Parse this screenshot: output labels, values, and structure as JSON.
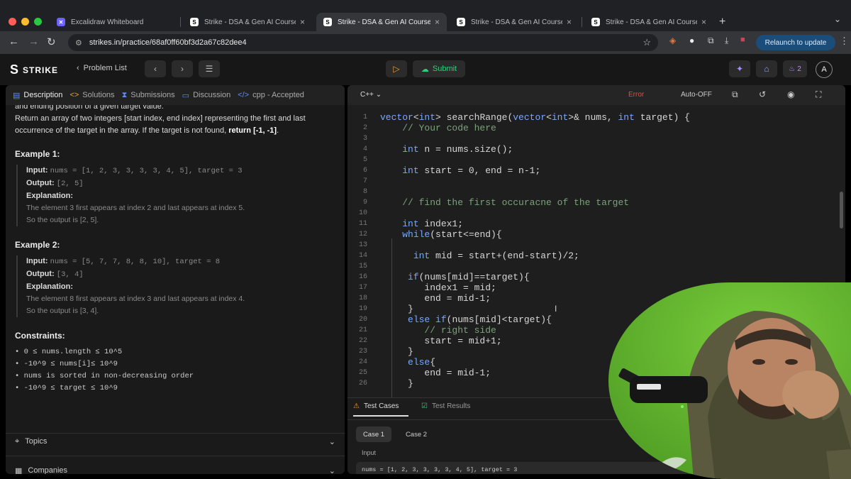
{
  "browser": {
    "tabs": [
      {
        "title": "Excalidraw Whiteboard",
        "active": false
      },
      {
        "title": "Strike - DSA & Gen AI Course",
        "active": false
      },
      {
        "title": "Strike - DSA & Gen AI Course",
        "active": true
      },
      {
        "title": "Strike - DSA & Gen AI Course",
        "active": false
      },
      {
        "title": "Strike - DSA & Gen AI Course",
        "active": false
      }
    ],
    "url": "strikes.in/practice/68af0ff60bf3d2a67c82dee4",
    "relaunch_label": "Relaunch to update"
  },
  "app": {
    "logo": "STRIKE",
    "problem_list": "Problem List",
    "submit_label": "Submit",
    "streak_count": "2",
    "avatar_letter": "A"
  },
  "left_tabs": [
    {
      "label": "Description",
      "icon": "document-icon"
    },
    {
      "label": "Solutions",
      "icon": "code-icon"
    },
    {
      "label": "Submissions",
      "icon": "hourglass-icon"
    },
    {
      "label": "Discussion",
      "icon": "chat-icon"
    },
    {
      "label": "cpp - Accepted",
      "icon": "code-icon"
    }
  ],
  "description": {
    "intro1": "and ending position of a given target value.",
    "intro2a": "Return an array of two integers [start index, end index] representing the first and last occurrence of the target in the array. If the target is not found, ",
    "intro2b": "return [-1, -1]",
    "intro2c": ".",
    "examples": [
      {
        "heading": "Example 1:",
        "input": "nums = [1, 2, 3, 3, 3, 3, 4, 5], target = 3",
        "output": "[2, 5]",
        "explanation1": "The element 3 first appears at index 2 and last appears at index 5.",
        "explanation2": "So the output is [2, 5]."
      },
      {
        "heading": "Example 2:",
        "input": "nums = [5, 7, 7, 8, 8, 10], target = 8",
        "output": "[3, 4]",
        "explanation1": "The element 8 first appears at index 3 and last appears at index 4.",
        "explanation2": "So the output is [3, 4]."
      }
    ],
    "input_label": "Input:",
    "output_label": "Output:",
    "explanation_label": "Explanation:",
    "constraints_heading": "Constraints:",
    "constraints": [
      "0 ≤ nums.length ≤ 10^5",
      "-10^9 ≤ nums[i]≤ 10^9",
      "nums is sorted in non-decreasing order",
      "-10^9 ≤ target ≤ 10^9"
    ],
    "topics": "Topics",
    "companies": "Companies"
  },
  "editor": {
    "language": "C++",
    "error_label": "Error",
    "autooff_label": "Auto-OFF",
    "lines": [
      {
        "n": "1",
        "text": "vector<int> searchRange(vector<int>& nums, int target) {"
      },
      {
        "n": "2",
        "text": "    // Your code here"
      },
      {
        "n": "3",
        "text": ""
      },
      {
        "n": "4",
        "text": "    int n = nums.size();"
      },
      {
        "n": "5",
        "text": ""
      },
      {
        "n": "6",
        "text": "    int start = 0, end = n-1;"
      },
      {
        "n": "7",
        "text": ""
      },
      {
        "n": "8",
        "text": ""
      },
      {
        "n": "9",
        "text": "    // find the first occuracne of the target"
      },
      {
        "n": "10",
        "text": ""
      },
      {
        "n": "11",
        "text": "    int index1;"
      },
      {
        "n": "12",
        "text": "    while(start<=end){"
      },
      {
        "n": "13",
        "text": ""
      },
      {
        "n": "14",
        "text": "      int mid = start+(end-start)/2;"
      },
      {
        "n": "15",
        "text": ""
      },
      {
        "n": "16",
        "text": "     if(nums[mid]==target){"
      },
      {
        "n": "17",
        "text": "        index1 = mid;"
      },
      {
        "n": "18",
        "text": "        end = mid-1;"
      },
      {
        "n": "19",
        "text": "     }"
      },
      {
        "n": "20",
        "text": "     else if(nums[mid]<target){"
      },
      {
        "n": "21",
        "text": "        // right side"
      },
      {
        "n": "22",
        "text": "        start = mid+1;"
      },
      {
        "n": "23",
        "text": "     }"
      },
      {
        "n": "24",
        "text": "     else{"
      },
      {
        "n": "25",
        "text": "        end = mid-1;"
      },
      {
        "n": "26",
        "text": "     }"
      }
    ],
    "tab_test_cases": "Test Cases",
    "tab_test_results": "Test Results",
    "case1": "Case 1",
    "case2": "Case 2",
    "input_label": "Input",
    "input_value": "nums = [1, 2, 3, 3, 3, 3, 4, 5], target = 3"
  },
  "colors": {
    "keyword": "#79a8ff",
    "comment": "#7aa37a",
    "submit_green": "#2fd07a",
    "error_red": "#e0503c"
  }
}
